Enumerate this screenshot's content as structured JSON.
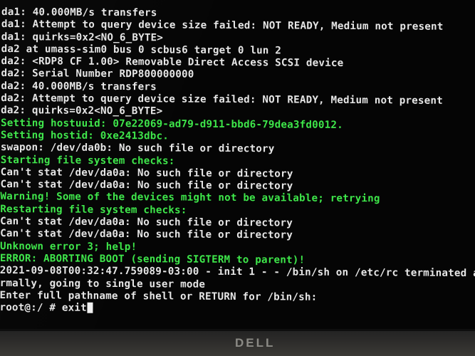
{
  "terminal": {
    "lines": [
      {
        "text": "da1: 40.000MB/s transfers",
        "color": "#e6e6e6"
      },
      {
        "text": "da1: Attempt to query device size failed: NOT READY, Medium not present",
        "color": "#e6e6e6"
      },
      {
        "text": "da1: quirks=0x2<NO_6_BYTE>",
        "color": "#e6e6e6"
      },
      {
        "text": "da2 at umass-sim0 bus 0 scbus6 target 0 lun 2",
        "color": "#e6e6e6"
      },
      {
        "text": "da2: <RDP8 CF 1.00> Removable Direct Access SCSI device",
        "color": "#e6e6e6"
      },
      {
        "text": "da2: Serial Number RDP800000000",
        "color": "#e6e6e6"
      },
      {
        "text": "da2: 40.000MB/s transfers",
        "color": "#e6e6e6"
      },
      {
        "text": "da2: Attempt to query device size failed: NOT READY, Medium not present",
        "color": "#e6e6e6"
      },
      {
        "text": "da2: quirks=0x2<NO_6_BYTE>",
        "color": "#e6e6e6"
      },
      {
        "text": "Setting hostuuid: 07e22069-ad79-d911-bbd6-79dea3fd0012.",
        "color": "#3ee64a"
      },
      {
        "text": "Setting hostid: 0xe2413dbc.",
        "color": "#3ee64a"
      },
      {
        "text": "swapon: /dev/da0b: No such file or directory",
        "color": "#e6e6e6"
      },
      {
        "text": "Starting file system checks:",
        "color": "#3ee64a"
      },
      {
        "text": "Can't stat /dev/da0a: No such file or directory",
        "color": "#e6e6e6"
      },
      {
        "text": "Can't stat /dev/da0a: No such file or directory",
        "color": "#e6e6e6"
      },
      {
        "text": "Warning! Some of the devices might not be available; retrying",
        "color": "#3ee64a"
      },
      {
        "text": "Restarting file system checks:",
        "color": "#3ee64a"
      },
      {
        "text": "Can't stat /dev/da0a: No such file or directory",
        "color": "#e6e6e6"
      },
      {
        "text": "Can't stat /dev/da0a: No such file or directory",
        "color": "#e6e6e6"
      },
      {
        "text": "Unknown error 3; help!",
        "color": "#3ee64a"
      },
      {
        "text": "ERROR: ABORTING BOOT (sending SIGTERM to parent)!",
        "color": "#3ee64a"
      },
      {
        "text": "2021-09-08T00:32:47.759089-03:00 - init 1 - - /bin/sh on /etc/rc terminated a",
        "color": "#e6e6e6"
      },
      {
        "text": "rmally, going to single user mode",
        "color": "#e6e6e6"
      },
      {
        "text": "Enter full pathname of shell or RETURN for /bin/sh:",
        "color": "#e6e6e6"
      }
    ],
    "prompt": "root@:/ # exit"
  },
  "monitor": {
    "brand": "DELL"
  }
}
